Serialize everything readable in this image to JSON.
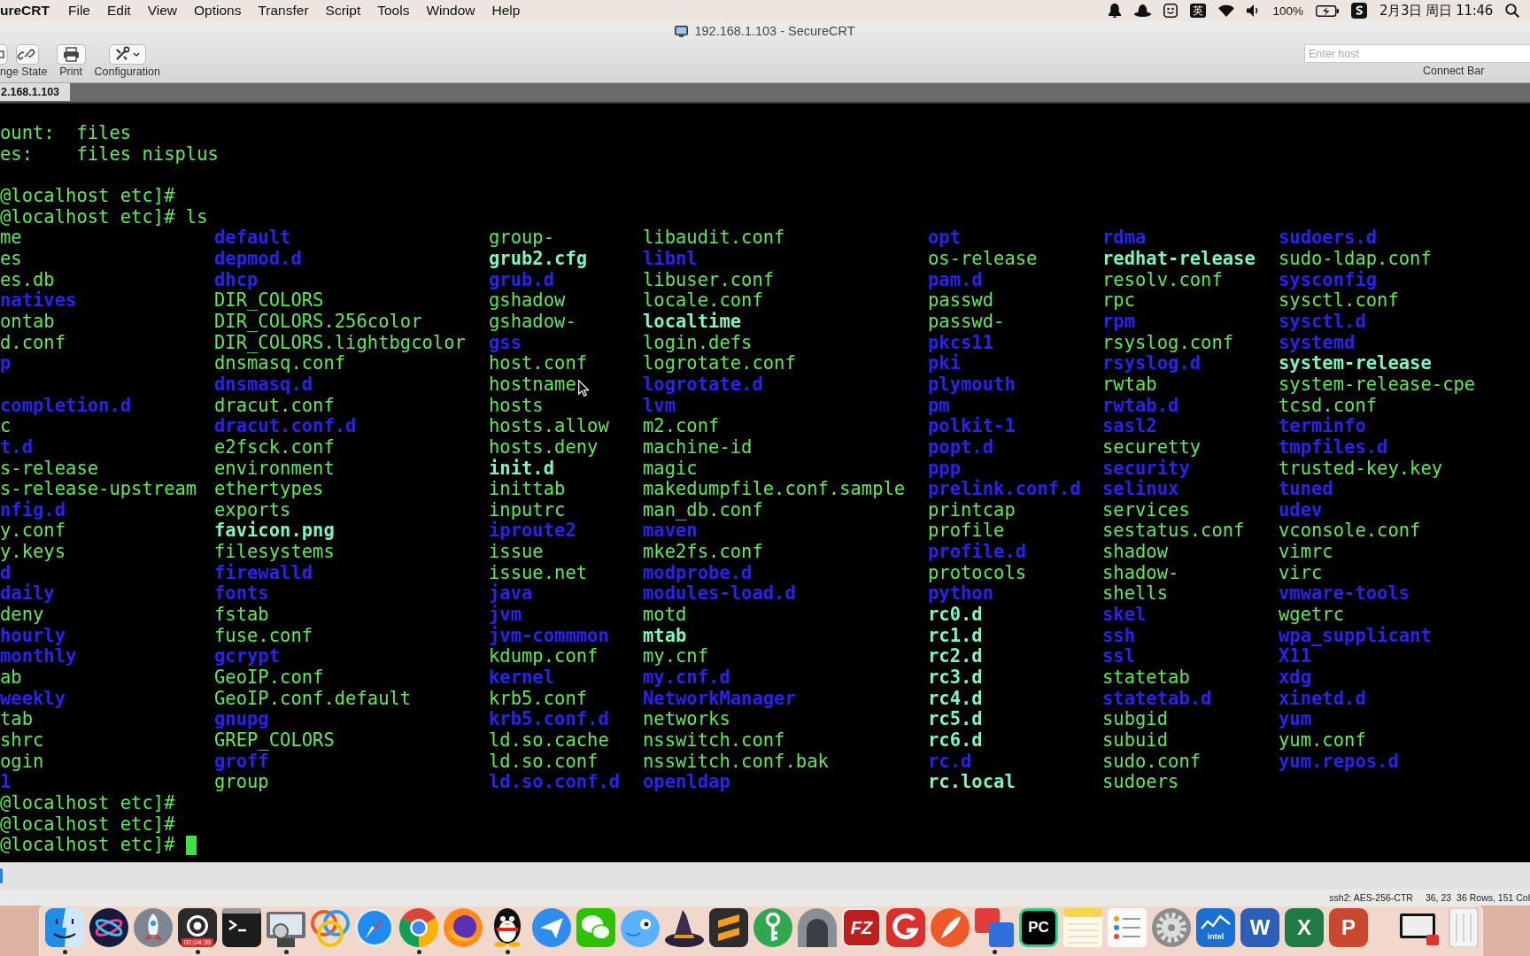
{
  "menu_bar": {
    "app": "ureCRT",
    "items": [
      "File",
      "Edit",
      "View",
      "Options",
      "Transfer",
      "Script",
      "Tools",
      "Window",
      "Help"
    ],
    "input_method": "英",
    "battery": "100%",
    "clock": "2月3日 周日 11:46"
  },
  "window": {
    "title": "192.168.1.103 - SecureCRT"
  },
  "toolbar": {
    "buttons": [
      {
        "kind": "state",
        "label": "nge State"
      },
      {
        "kind": "print",
        "label": "Print"
      },
      {
        "kind": "config",
        "label": "Configuration"
      }
    ],
    "connect_bar": {
      "placeholder": "Enter host",
      "label": "Connect Bar"
    }
  },
  "tabs": [
    {
      "label": "2.168.1.103",
      "selected": true
    }
  ],
  "terminal": {
    "lines": [
      {
        "kind": "output",
        "text": "ount:  files"
      },
      {
        "kind": "output",
        "text": "es:    files nisplus"
      },
      {
        "kind": "blank"
      },
      {
        "kind": "prompt",
        "prompt": "@localhost etc]#",
        "cursor": false
      },
      {
        "kind": "prompt",
        "prompt": "@localhost etc]#",
        "command": "ls",
        "cursor": false
      },
      {
        "kind": "listing",
        "rows": [
          [
            {
              "text": "me",
              "kind": "file"
            },
            {
              "text": "default",
              "kind": "dir"
            },
            {
              "text": "group-",
              "kind": "file"
            },
            {
              "text": "libaudit.conf",
              "kind": "file"
            },
            {
              "text": "opt",
              "kind": "dir"
            },
            {
              "text": "rdma",
              "kind": "dir"
            },
            {
              "text": "sudoers.d",
              "kind": "dir"
            }
          ],
          [
            {
              "text": "es",
              "kind": "file"
            },
            {
              "text": "depmod.d",
              "kind": "dir"
            },
            {
              "text": "grub2.cfg",
              "kind": "link"
            },
            {
              "text": "libnl",
              "kind": "dir"
            },
            {
              "text": "os-release",
              "kind": "file"
            },
            {
              "text": "redhat-release",
              "kind": "link"
            },
            {
              "text": "sudo-ldap.conf",
              "kind": "file"
            }
          ],
          [
            {
              "text": "es.db",
              "kind": "file"
            },
            {
              "text": "dhcp",
              "kind": "dir"
            },
            {
              "text": "grub.d",
              "kind": "dir"
            },
            {
              "text": "libuser.conf",
              "kind": "file"
            },
            {
              "text": "pam.d",
              "kind": "dir"
            },
            {
              "text": "resolv.conf",
              "kind": "file"
            },
            {
              "text": "sysconfig",
              "kind": "dir"
            }
          ],
          [
            {
              "text": "natives",
              "kind": "dir"
            },
            {
              "text": "DIR_COLORS",
              "kind": "file"
            },
            {
              "text": "gshadow",
              "kind": "file"
            },
            {
              "text": "locale.conf",
              "kind": "file"
            },
            {
              "text": "passwd",
              "kind": "file"
            },
            {
              "text": "rpc",
              "kind": "file"
            },
            {
              "text": "sysctl.conf",
              "kind": "file"
            }
          ],
          [
            {
              "text": "ontab",
              "kind": "file"
            },
            {
              "text": "DIR_COLORS.256color",
              "kind": "file"
            },
            {
              "text": "gshadow-",
              "kind": "file"
            },
            {
              "text": "localtime",
              "kind": "link"
            },
            {
              "text": "passwd-",
              "kind": "file"
            },
            {
              "text": "rpm",
              "kind": "dir"
            },
            {
              "text": "sysctl.d",
              "kind": "dir"
            }
          ],
          [
            {
              "text": "d.conf",
              "kind": "file"
            },
            {
              "text": "DIR_COLORS.lightbgcolor",
              "kind": "file"
            },
            {
              "text": "gss",
              "kind": "dir"
            },
            {
              "text": "login.defs",
              "kind": "file"
            },
            {
              "text": "pkcs11",
              "kind": "dir"
            },
            {
              "text": "rsyslog.conf",
              "kind": "file"
            },
            {
              "text": "systemd",
              "kind": "dir"
            }
          ],
          [
            {
              "text": "p",
              "kind": "dir"
            },
            {
              "text": "dnsmasq.conf",
              "kind": "file"
            },
            {
              "text": "host.conf",
              "kind": "file"
            },
            {
              "text": "logrotate.conf",
              "kind": "file"
            },
            {
              "text": "pki",
              "kind": "dir"
            },
            {
              "text": "rsyslog.d",
              "kind": "dir"
            },
            {
              "text": "system-release",
              "kind": "link"
            }
          ],
          [
            null,
            {
              "text": "dnsmasq.d",
              "kind": "dir"
            },
            {
              "text": "hostname",
              "kind": "file"
            },
            {
              "text": "logrotate.d",
              "kind": "dir"
            },
            {
              "text": "plymouth",
              "kind": "dir"
            },
            {
              "text": "rwtab",
              "kind": "file"
            },
            {
              "text": "system-release-cpe",
              "kind": "file"
            }
          ],
          [
            {
              "text": "completion.d",
              "kind": "dir"
            },
            {
              "text": "dracut.conf",
              "kind": "file"
            },
            {
              "text": "hosts",
              "kind": "file"
            },
            {
              "text": "lvm",
              "kind": "dir"
            },
            {
              "text": "pm",
              "kind": "dir"
            },
            {
              "text": "rwtab.d",
              "kind": "dir"
            },
            {
              "text": "tcsd.conf",
              "kind": "file"
            }
          ],
          [
            {
              "text": "c",
              "kind": "file"
            },
            {
              "text": "dracut.conf.d",
              "kind": "dir"
            },
            {
              "text": "hosts.allow",
              "kind": "file"
            },
            {
              "text": "m2.conf",
              "kind": "file"
            },
            {
              "text": "polkit-1",
              "kind": "dir"
            },
            {
              "text": "sasl2",
              "kind": "dir"
            },
            {
              "text": "terminfo",
              "kind": "dir"
            }
          ],
          [
            {
              "text": "t.d",
              "kind": "dir"
            },
            {
              "text": "e2fsck.conf",
              "kind": "file"
            },
            {
              "text": "hosts.deny",
              "kind": "file"
            },
            {
              "text": "machine-id",
              "kind": "file"
            },
            {
              "text": "popt.d",
              "kind": "dir"
            },
            {
              "text": "securetty",
              "kind": "file"
            },
            {
              "text": "tmpfiles.d",
              "kind": "dir"
            }
          ],
          [
            {
              "text": "s-release",
              "kind": "file"
            },
            {
              "text": "environment",
              "kind": "file"
            },
            {
              "text": "init.d",
              "kind": "link"
            },
            {
              "text": "magic",
              "kind": "file"
            },
            {
              "text": "ppp",
              "kind": "dir"
            },
            {
              "text": "security",
              "kind": "dir"
            },
            {
              "text": "trusted-key.key",
              "kind": "file"
            }
          ],
          [
            {
              "text": "s-release-upstream",
              "kind": "file"
            },
            {
              "text": "ethertypes",
              "kind": "file"
            },
            {
              "text": "inittab",
              "kind": "file"
            },
            {
              "text": "makedumpfile.conf.sample",
              "kind": "file"
            },
            {
              "text": "prelink.conf.d",
              "kind": "dir"
            },
            {
              "text": "selinux",
              "kind": "dir"
            },
            {
              "text": "tuned",
              "kind": "dir"
            }
          ],
          [
            {
              "text": "nfig.d",
              "kind": "dir"
            },
            {
              "text": "exports",
              "kind": "file"
            },
            {
              "text": "inputrc",
              "kind": "file"
            },
            {
              "text": "man_db.conf",
              "kind": "file"
            },
            {
              "text": "printcap",
              "kind": "file"
            },
            {
              "text": "services",
              "kind": "file"
            },
            {
              "text": "udev",
              "kind": "dir"
            }
          ],
          [
            {
              "text": "y.conf",
              "kind": "file"
            },
            {
              "text": "favicon.png",
              "kind": "link"
            },
            {
              "text": "iproute2",
              "kind": "dir"
            },
            {
              "text": "maven",
              "kind": "dir"
            },
            {
              "text": "profile",
              "kind": "file"
            },
            {
              "text": "sestatus.conf",
              "kind": "file"
            },
            {
              "text": "vconsole.conf",
              "kind": "file"
            }
          ],
          [
            {
              "text": "y.keys",
              "kind": "file"
            },
            {
              "text": "filesystems",
              "kind": "file"
            },
            {
              "text": "issue",
              "kind": "file"
            },
            {
              "text": "mke2fs.conf",
              "kind": "file"
            },
            {
              "text": "profile.d",
              "kind": "dir"
            },
            {
              "text": "shadow",
              "kind": "file"
            },
            {
              "text": "vimrc",
              "kind": "file"
            }
          ],
          [
            {
              "text": "d",
              "kind": "dir"
            },
            {
              "text": "firewalld",
              "kind": "dir"
            },
            {
              "text": "issue.net",
              "kind": "file"
            },
            {
              "text": "modprobe.d",
              "kind": "dir"
            },
            {
              "text": "protocols",
              "kind": "file"
            },
            {
              "text": "shadow-",
              "kind": "file"
            },
            {
              "text": "virc",
              "kind": "file"
            }
          ],
          [
            {
              "text": "daily",
              "kind": "dir"
            },
            {
              "text": "fonts",
              "kind": "dir"
            },
            {
              "text": "java",
              "kind": "dir"
            },
            {
              "text": "modules-load.d",
              "kind": "dir"
            },
            {
              "text": "python",
              "kind": "dir"
            },
            {
              "text": "shells",
              "kind": "file"
            },
            {
              "text": "vmware-tools",
              "kind": "dir"
            }
          ],
          [
            {
              "text": "deny",
              "kind": "file"
            },
            {
              "text": "fstab",
              "kind": "file"
            },
            {
              "text": "jvm",
              "kind": "dir"
            },
            {
              "text": "motd",
              "kind": "file"
            },
            {
              "text": "rc0.d",
              "kind": "link"
            },
            {
              "text": "skel",
              "kind": "dir"
            },
            {
              "text": "wgetrc",
              "kind": "file"
            }
          ],
          [
            {
              "text": "hourly",
              "kind": "dir"
            },
            {
              "text": "fuse.conf",
              "kind": "file"
            },
            {
              "text": "jvm-commmon",
              "kind": "dir"
            },
            {
              "text": "mtab",
              "kind": "link"
            },
            {
              "text": "rc1.d",
              "kind": "link"
            },
            {
              "text": "ssh",
              "kind": "dir"
            },
            {
              "text": "wpa_supplicant",
              "kind": "dir"
            }
          ],
          [
            {
              "text": "monthly",
              "kind": "dir"
            },
            {
              "text": "gcrypt",
              "kind": "dir"
            },
            {
              "text": "kdump.conf",
              "kind": "file"
            },
            {
              "text": "my.cnf",
              "kind": "file"
            },
            {
              "text": "rc2.d",
              "kind": "link"
            },
            {
              "text": "ssl",
              "kind": "dir"
            },
            {
              "text": "X11",
              "kind": "dir"
            }
          ],
          [
            {
              "text": "ab",
              "kind": "file"
            },
            {
              "text": "GeoIP.conf",
              "kind": "file"
            },
            {
              "text": "kernel",
              "kind": "dir"
            },
            {
              "text": "my.cnf.d",
              "kind": "dir"
            },
            {
              "text": "rc3.d",
              "kind": "link"
            },
            {
              "text": "statetab",
              "kind": "file"
            },
            {
              "text": "xdg",
              "kind": "dir"
            }
          ],
          [
            {
              "text": "weekly",
              "kind": "dir"
            },
            {
              "text": "GeoIP.conf.default",
              "kind": "file"
            },
            {
              "text": "krb5.conf",
              "kind": "file"
            },
            {
              "text": "NetworkManager",
              "kind": "dir"
            },
            {
              "text": "rc4.d",
              "kind": "link"
            },
            {
              "text": "statetab.d",
              "kind": "dir"
            },
            {
              "text": "xinetd.d",
              "kind": "dir"
            }
          ],
          [
            {
              "text": "tab",
              "kind": "file"
            },
            {
              "text": "gnupg",
              "kind": "dir"
            },
            {
              "text": "krb5.conf.d",
              "kind": "dir"
            },
            {
              "text": "networks",
              "kind": "file"
            },
            {
              "text": "rc5.d",
              "kind": "link"
            },
            {
              "text": "subgid",
              "kind": "file"
            },
            {
              "text": "yum",
              "kind": "dir"
            }
          ],
          [
            {
              "text": "shrc",
              "kind": "file"
            },
            {
              "text": "GREP_COLORS",
              "kind": "file"
            },
            {
              "text": "ld.so.cache",
              "kind": "file"
            },
            {
              "text": "nsswitch.conf",
              "kind": "file"
            },
            {
              "text": "rc6.d",
              "kind": "link"
            },
            {
              "text": "subuid",
              "kind": "file"
            },
            {
              "text": "yum.conf",
              "kind": "file"
            }
          ],
          [
            {
              "text": "ogin",
              "kind": "file"
            },
            {
              "text": "groff",
              "kind": "dir"
            },
            {
              "text": "ld.so.conf",
              "kind": "file"
            },
            {
              "text": "nsswitch.conf.bak",
              "kind": "file"
            },
            {
              "text": "rc.d",
              "kind": "dir"
            },
            {
              "text": "sudo.conf",
              "kind": "file"
            },
            {
              "text": "yum.repos.d",
              "kind": "dir"
            }
          ],
          [
            {
              "text": "1",
              "kind": "dir"
            },
            {
              "text": "group",
              "kind": "file"
            },
            {
              "text": "ld.so.conf.d",
              "kind": "dir"
            },
            {
              "text": "openldap",
              "kind": "dir"
            },
            {
              "text": "rc.local",
              "kind": "link"
            },
            {
              "text": "sudoers",
              "kind": "file"
            }
          ]
        ]
      },
      {
        "kind": "prompt",
        "prompt": "@localhost etc]#",
        "cursor": false
      },
      {
        "kind": "prompt",
        "prompt": "@localhost etc]#",
        "cursor": false
      },
      {
        "kind": "prompt",
        "prompt": "@localhost etc]#",
        "cursor": true
      }
    ]
  },
  "status_bar": {
    "cipher": "ssh2: AES-256-CTR",
    "position": "36, 23",
    "size": "36 Rows, 151 Col"
  },
  "dock": {
    "apps": [
      {
        "kind": "face",
        "running": true
      },
      {
        "kind": "orb",
        "running": false
      },
      {
        "kind": "rocket",
        "running": false
      },
      {
        "kind": "recorder",
        "label": "00:04:39",
        "running": true
      },
      {
        "kind": "terminal",
        "running": false
      },
      {
        "kind": "viewer",
        "running": true
      },
      {
        "kind": "rings",
        "running": false
      },
      {
        "kind": "compass",
        "running": false
      },
      {
        "kind": "tricolor",
        "running": true
      },
      {
        "kind": "fox",
        "running": false
      },
      {
        "kind": "penguin",
        "running": true
      },
      {
        "kind": "plane",
        "running": false
      },
      {
        "kind": "chat",
        "running": false
      },
      {
        "kind": "bird",
        "running": false
      },
      {
        "kind": "witch_hat",
        "running": false
      },
      {
        "kind": "stripes",
        "running": false
      },
      {
        "kind": "key",
        "running": false
      },
      {
        "kind": "tunnel",
        "running": false
      },
      {
        "kind": "red_tile",
        "label": "FZ",
        "running": false
      },
      {
        "kind": "ring_tile",
        "running": false
      },
      {
        "kind": "quill",
        "running": false
      },
      {
        "kind": "windows",
        "running": true
      },
      {
        "kind": "dark_tile",
        "label": "PC",
        "running": false
      },
      {
        "kind": "notepad",
        "running": false
      },
      {
        "kind": "checklist",
        "running": false
      },
      {
        "kind": "gear",
        "running": false
      },
      {
        "kind": "graph_tile",
        "label": "intel",
        "running": false
      },
      {
        "kind": "blue_tile",
        "label": "W",
        "running": false
      },
      {
        "kind": "green_tile",
        "label": "X",
        "running": false
      },
      {
        "kind": "orange_tile",
        "label": "P",
        "running": false
      }
    ],
    "extras": [
      {
        "kind": "display",
        "running": false
      },
      {
        "kind": "trash",
        "running": false
      }
    ]
  }
}
